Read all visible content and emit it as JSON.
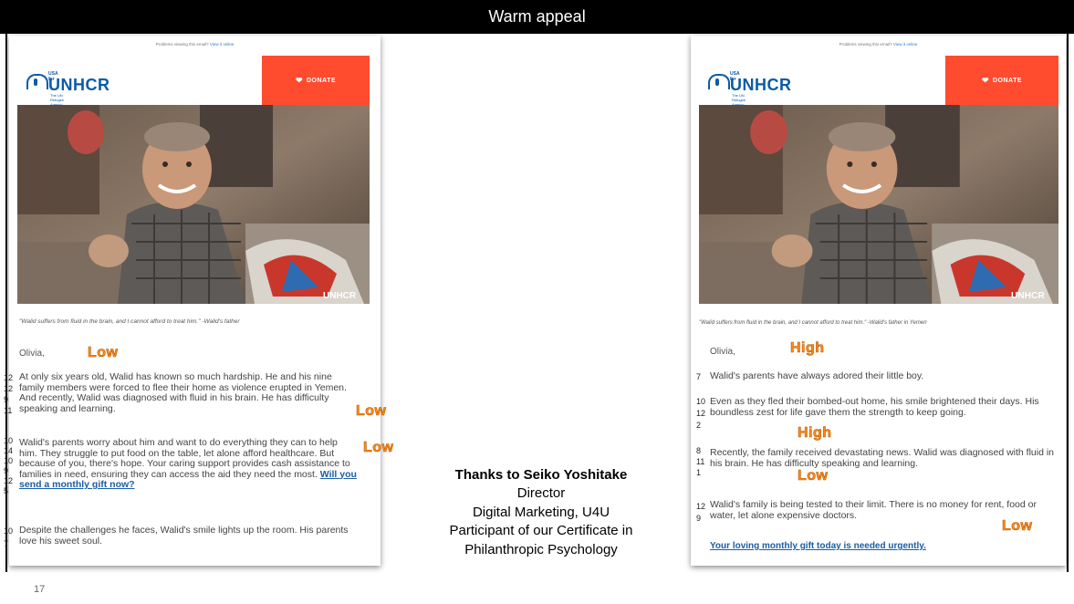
{
  "header": {
    "title": "Warm appeal"
  },
  "page_number": "17",
  "email_common": {
    "preheader": "Problems viewing this email?",
    "view_link": "View it online",
    "logo_small": "USA for",
    "logo_text": "UNHCR",
    "logo_tag": "The UN Refugee Agency",
    "donate_label": "DONATE",
    "photo_watermark": "UNHCR",
    "salutation": "Olivia,"
  },
  "left_email": {
    "caption": "\"Walid suffers from fluid in the brain, and I cannot afford to treat him.\" -Walid's father",
    "tag_salutation": "Low",
    "paragraphs": [
      {
        "text": "At only six years old, Walid has known so much hardship. He and his nine family members were forced to flee their home as violence erupted in Yemen. And recently, Walid was diagnosed with fluid in his brain. He has difficulty speaking and learning.",
        "numbers": [
          "12",
          "12",
          "9",
          "11"
        ],
        "tag": "Low"
      },
      {
        "text": "Walid's parents worry about him and want to do everything they can to help him. They struggle to put food on the table, let alone afford healthcare. But because of you, there's hope. Your caring support provides cash assistance to families in need, ensuring they can access the aid they need the most.",
        "link": "Will you send a monthly gift now?",
        "numbers": [
          "10",
          "14",
          "10",
          "9",
          "12",
          "5"
        ],
        "tag": "Low"
      },
      {
        "text": "Despite the challenges he faces, Walid's smile lights up the room. His parents love his sweet soul.",
        "numbers": [
          "10",
          "7"
        ]
      }
    ]
  },
  "right_email": {
    "caption": "\"Walid suffers from fluid in the brain, and I cannot afford to treat him.\" -Walid's father in Yemen",
    "tag_salutation": "High",
    "paragraphs": [
      {
        "text": "Walid's parents have always adored their little boy.",
        "numbers": [
          "7"
        ]
      },
      {
        "text": "Even as they fled their bombed-out home, his smile brightened their days. His boundless zest for life gave them the strength to keep going.",
        "numbers": [
          "10",
          "12",
          "2"
        ],
        "tag": "High"
      },
      {
        "text": "Recently, the family received devastating news. Walid was diagnosed with fluid in his brain. He has difficulty speaking and learning.",
        "numbers": [
          "8",
          "11",
          "1"
        ],
        "tag": "Low"
      },
      {
        "text": "Walid's family is being tested to their limit. There is no money for rent, food or water, let alone expensive doctors.",
        "numbers": [
          "12",
          "9"
        ],
        "tag": "Low"
      }
    ],
    "cta": "Your loving monthly gift today is needed urgently."
  },
  "credits": {
    "name": "Thanks to Seiko Yoshitake",
    "role": "Director",
    "dept": "Digital Marketing, U4U",
    "line3": "Participant of our Certificate in",
    "line4": "Philanthropic Psychology"
  },
  "colors": {
    "donate_bg": "#ff4c2f",
    "unhcr_blue": "#0a5ba8",
    "tag_orange": "#ff8c1a",
    "link_blue": "#1a5ea6"
  }
}
